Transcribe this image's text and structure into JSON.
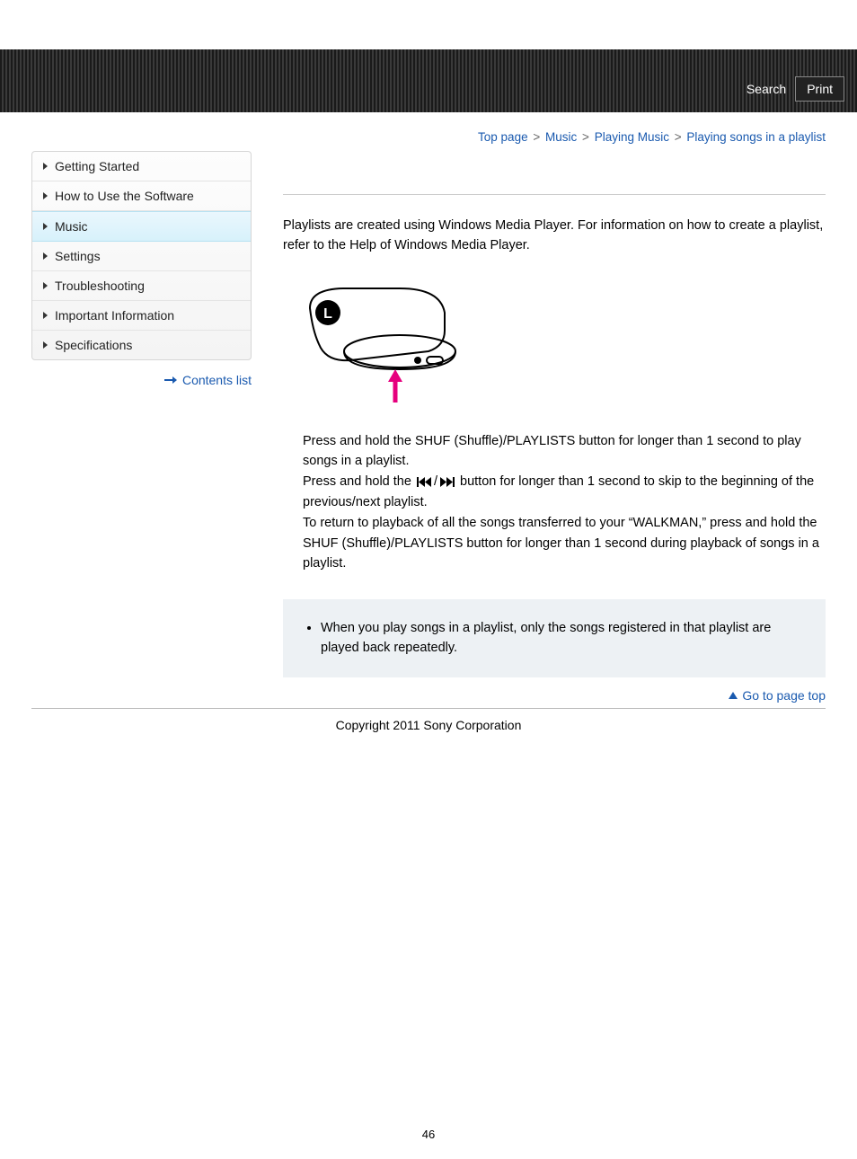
{
  "header": {
    "search_label": "Search",
    "print_label": "Print"
  },
  "breadcrumb": {
    "items": [
      {
        "label": "Top page"
      },
      {
        "label": "Music"
      },
      {
        "label": "Playing Music"
      },
      {
        "label": "Playing songs in a playlist"
      }
    ],
    "separator": ">"
  },
  "sidebar": {
    "items": [
      {
        "label": "Getting Started",
        "active": false
      },
      {
        "label": "How to Use the Software",
        "active": false
      },
      {
        "label": "Music",
        "active": true
      },
      {
        "label": "Settings",
        "active": false
      },
      {
        "label": "Troubleshooting",
        "active": false
      },
      {
        "label": "Important Information",
        "active": false
      },
      {
        "label": "Specifications",
        "active": false
      }
    ],
    "contents_list_label": "Contents list"
  },
  "main": {
    "intro": "Playlists are created using Windows Media Player. For information on how to create a playlist, refer to the Help of Windows Media Player.",
    "instr1": "Press and hold the SHUF (Shuffle)/PLAYLISTS button for longer than 1 second to play songs in a playlist.",
    "instr2a": "Press and hold the ",
    "instr2b": " button for longer than 1 second to skip to the beginning of the previous/next playlist.",
    "instr3": "To return to playback of all the songs transferred to your “WALKMAN,” press and hold the SHUF (Shuffle)/PLAYLISTS button for longer than 1 second during playback of songs in a playlist.",
    "note": "When you play songs in a playlist, only the songs registered in that playlist are played back repeatedly.",
    "goto_top_label": "Go to page top"
  },
  "footer": {
    "copyright": "Copyright 2011 Sony Corporation",
    "page_number": "46"
  }
}
